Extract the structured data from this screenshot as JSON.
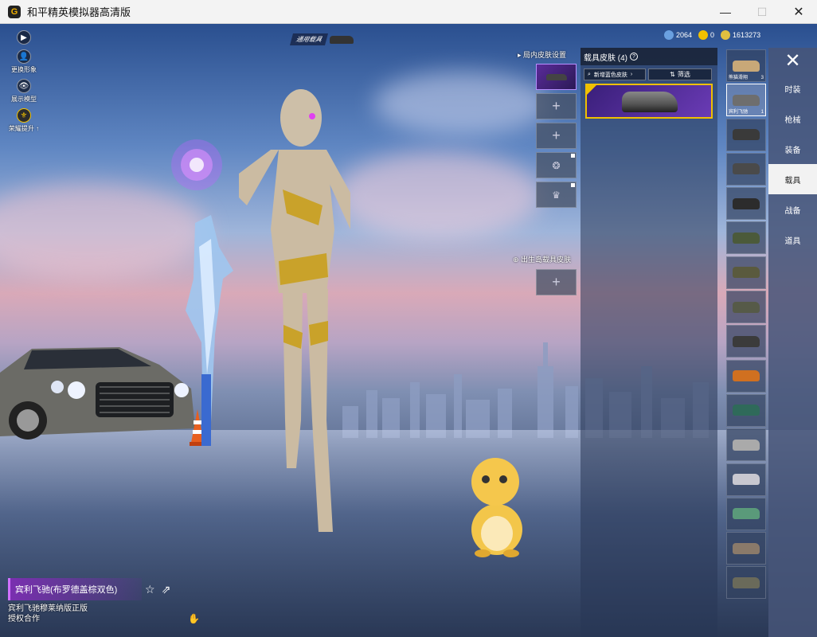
{
  "window": {
    "title": "和平精英模拟器高清版",
    "logo": "G",
    "min": "—",
    "max": "☐",
    "close": "✕"
  },
  "left_tools": [
    {
      "icon": "play-icon",
      "glyph": "▶",
      "label": ""
    },
    {
      "icon": "person-icon",
      "glyph": "👤",
      "label": "更换形象"
    },
    {
      "icon": "eye-icon",
      "glyph": "👁",
      "label": "展示模型"
    },
    {
      "icon": "emblem-icon",
      "glyph": "⚜",
      "label": "荣耀提升 ↑"
    }
  ],
  "vehicle_chip": {
    "label": "通用载具"
  },
  "currencies": [
    {
      "value": "2064",
      "color": "#6aa0e0"
    },
    {
      "value": "0",
      "color": "#f0c000"
    },
    {
      "value": "1613273",
      "color": "#e0c040"
    }
  ],
  "skin_setting": {
    "title": "▸ 局内皮肤设置",
    "spawn_title": "⊕ 出生岛载具皮肤",
    "plus": "+"
  },
  "skin_panel": {
    "title": "载具皮肤 (4)",
    "help": "?",
    "sort_label": "新增蓝色皮肤",
    "sort_arrow": "›",
    "filter_label": "筛选",
    "selected_card": "宾利飞驰"
  },
  "vehicles": [
    {
      "label": "熊猫滑翔",
      "count": "3",
      "color": "#c8a878"
    },
    {
      "label": "宾利飞驰",
      "count": "1",
      "color": "#6e6e6e",
      "active": true
    },
    {
      "label": "",
      "count": "",
      "color": "#3a3a3a"
    },
    {
      "label": "",
      "count": "",
      "color": "#4a4a4a"
    },
    {
      "label": "",
      "count": "",
      "color": "#2c2c2c"
    },
    {
      "label": "",
      "count": "",
      "color": "#4b5a3a"
    },
    {
      "label": "",
      "count": "",
      "color": "#5a5a3e"
    },
    {
      "label": "",
      "count": "",
      "color": "#565a48"
    },
    {
      "label": "",
      "count": "",
      "color": "#3b3b3b"
    },
    {
      "label": "",
      "count": "",
      "color": "#d07020"
    },
    {
      "label": "",
      "count": "",
      "color": "#2f6a5a"
    },
    {
      "label": "",
      "count": "",
      "color": "#aaaaaa"
    },
    {
      "label": "",
      "count": "",
      "color": "#c8c8d0"
    },
    {
      "label": "",
      "count": "",
      "color": "#5a9a7a"
    },
    {
      "label": "",
      "count": "",
      "color": "#8a7a6a"
    },
    {
      "label": "",
      "count": "",
      "color": "#6a6a5a"
    }
  ],
  "categories": [
    {
      "label": "时装",
      "active": false
    },
    {
      "label": "枪械",
      "active": false
    },
    {
      "label": "装备",
      "active": false
    },
    {
      "label": "载具",
      "active": true
    },
    {
      "label": "战备",
      "active": false
    },
    {
      "label": "道具",
      "active": false
    }
  ],
  "bottom_info": {
    "name": "宾利飞驰(布罗德盖棕双色)",
    "license_line1": "宾利飞驰穆莱纳版正版",
    "license_line2": "授权合作",
    "favorite": "☆",
    "share": "⇗",
    "hand": "✋"
  },
  "colors": {
    "accent": "#f0c000",
    "purple": "#7a2fb0",
    "nav_active_bg": "#f2f2f2"
  }
}
